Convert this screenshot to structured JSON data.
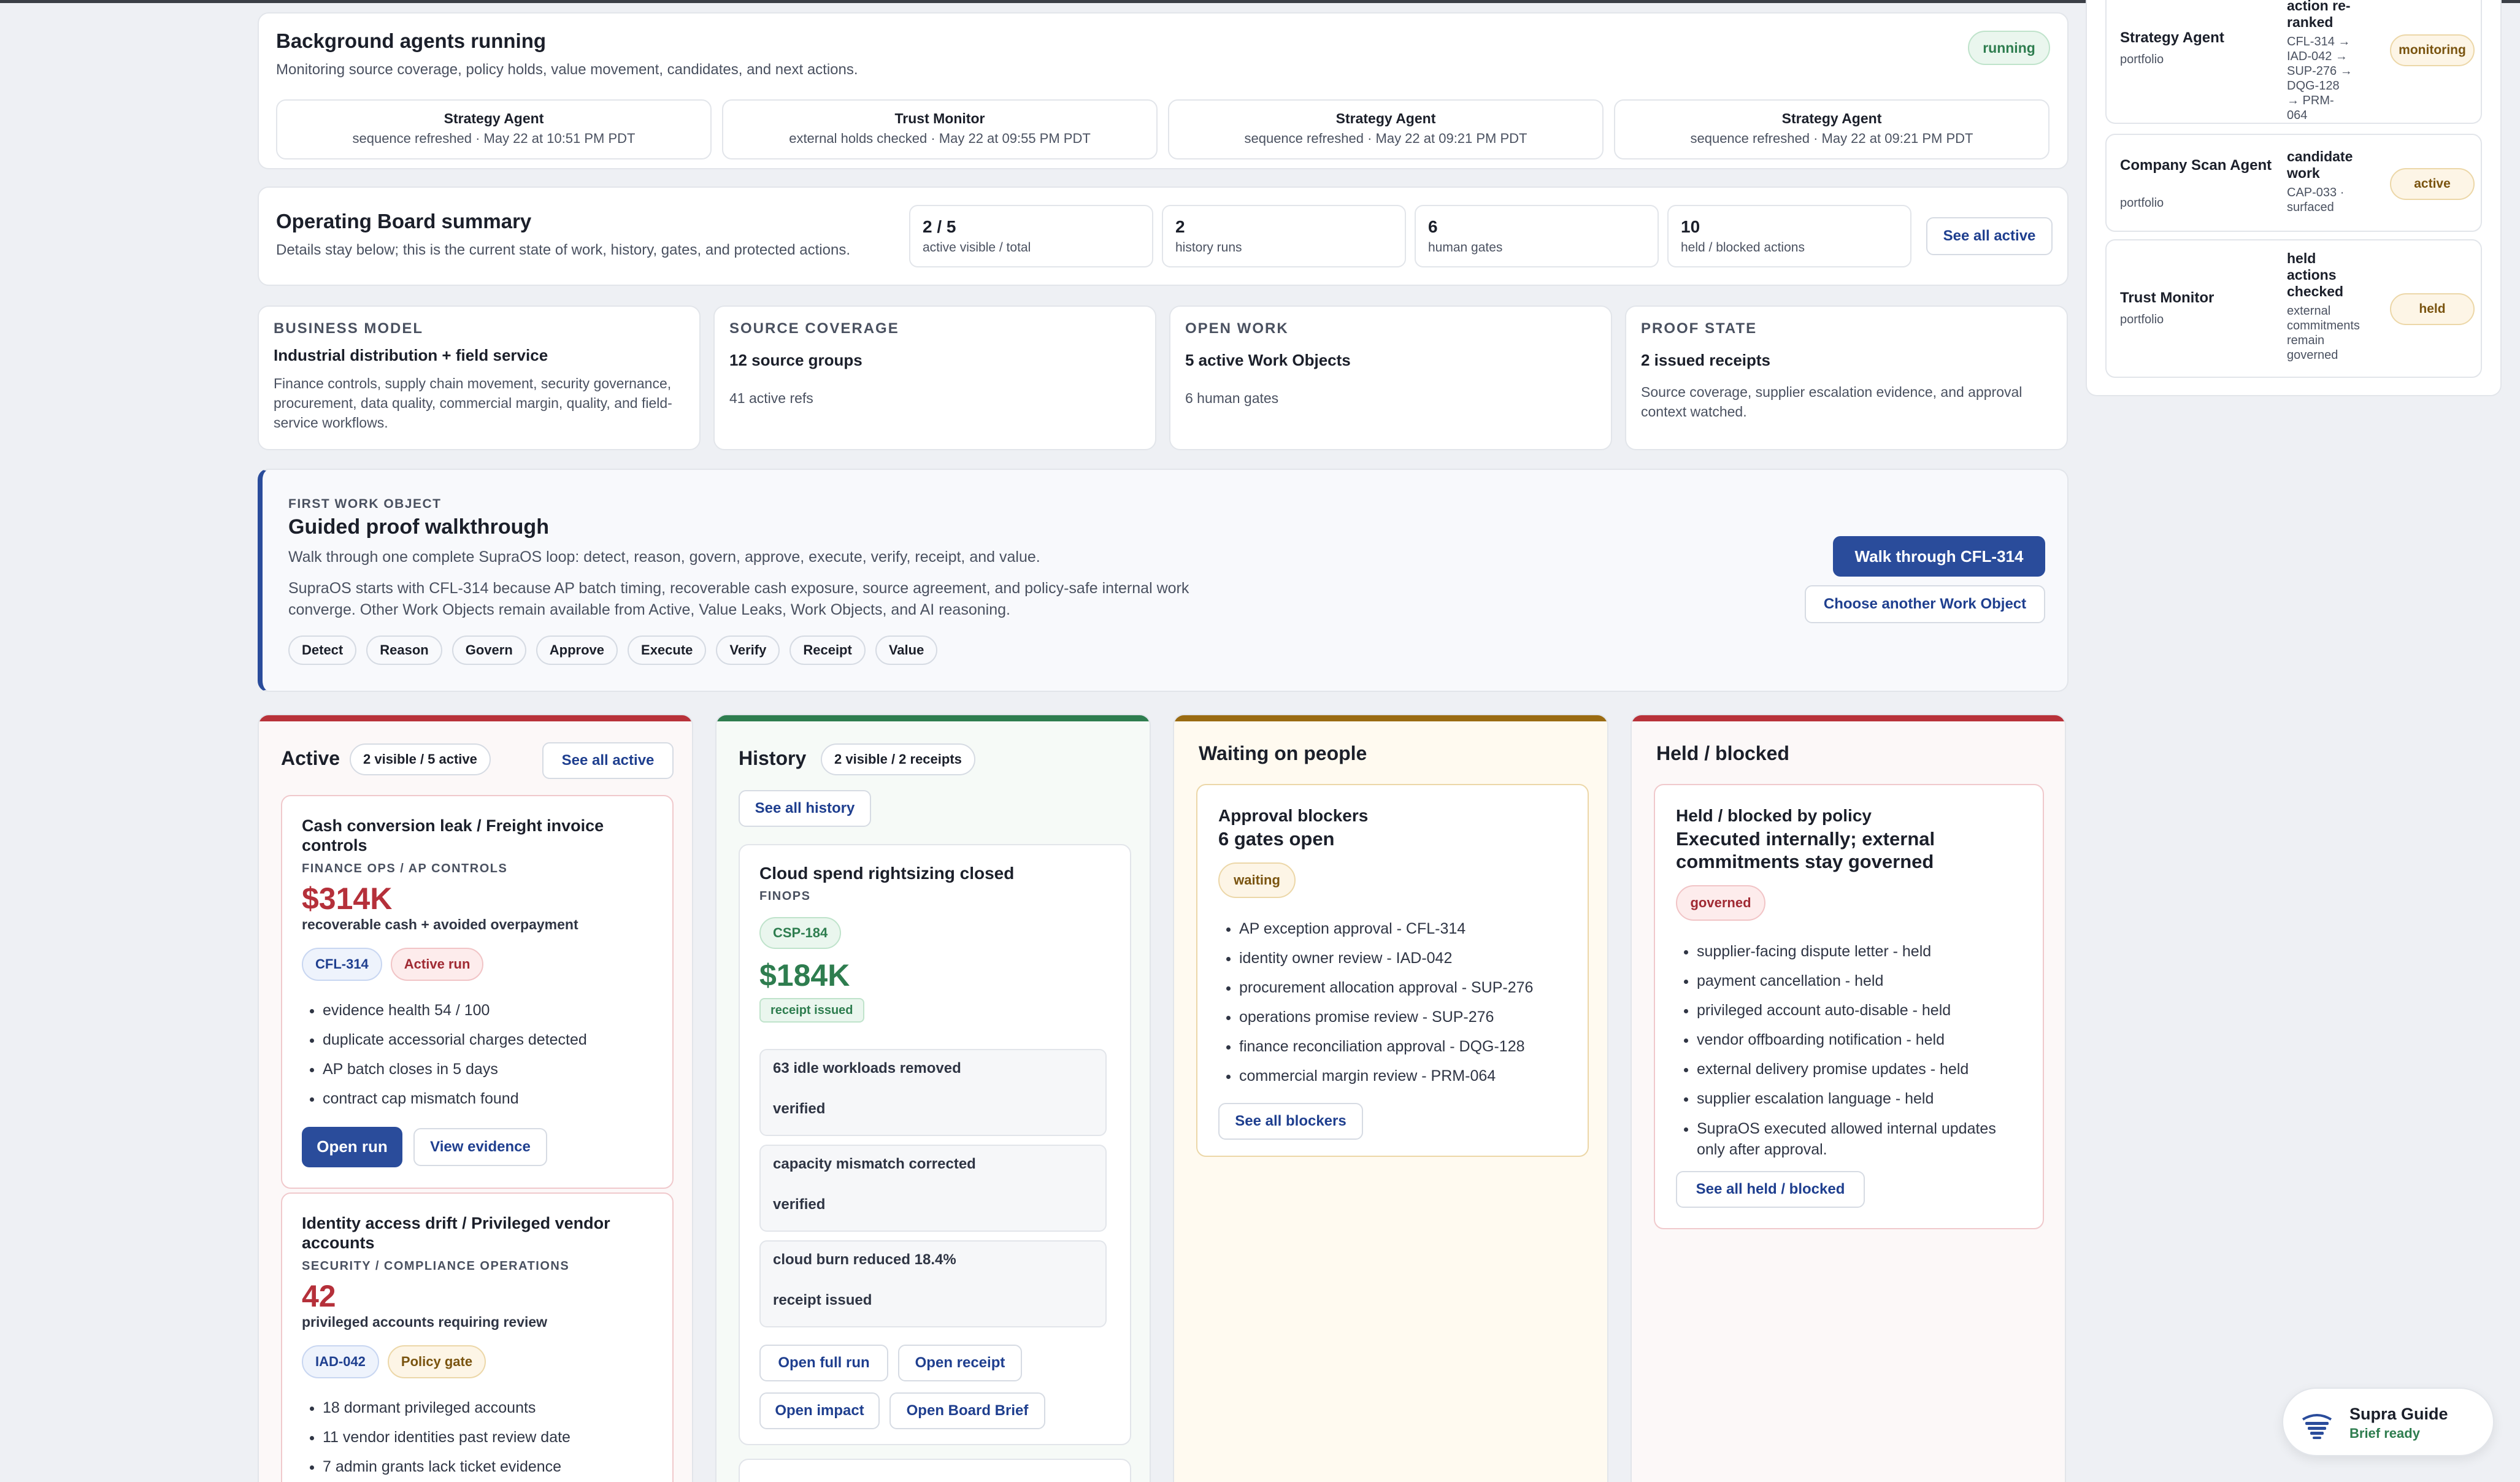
{
  "agents_card": {
    "title": "Background agents running",
    "subtitle": "Monitoring source coverage, policy holds, value movement, candidates, and next actions.",
    "status": "running",
    "agents": [
      {
        "name": "Strategy Agent",
        "status": "sequence refreshed · May 22 at 10:51 PM PDT"
      },
      {
        "name": "Trust Monitor",
        "status": "external holds checked · May 22 at 09:55 PM PDT"
      },
      {
        "name": "Strategy Agent",
        "status": "sequence refreshed · May 22 at 09:21 PM PDT"
      },
      {
        "name": "Strategy Agent",
        "status": "sequence refreshed · May 22 at 09:21 PM PDT"
      }
    ]
  },
  "summary": {
    "title": "Operating Board summary",
    "subtitle": "Details stay below; this is the current state of work, history, gates, and protected actions.",
    "stats": [
      {
        "value": "2 / 5",
        "label": "active visible / total"
      },
      {
        "value": "2",
        "label": "history runs"
      },
      {
        "value": "6",
        "label": "human gates"
      },
      {
        "value": "10",
        "label": "held / blocked actions"
      }
    ],
    "see_all": "See all active"
  },
  "metrics": [
    {
      "label": "BUSINESS MODEL",
      "title": "Industrial distribution + field service",
      "desc": "Finance controls, supply chain movement, security governance, procurement, data quality, commercial margin, quality, and field-service workflows."
    },
    {
      "label": "SOURCE COVERAGE",
      "title": "12 source groups",
      "desc": "41 active refs"
    },
    {
      "label": "OPEN WORK",
      "title": "5 active Work Objects",
      "desc": "6 human gates"
    },
    {
      "label": "PROOF STATE",
      "title": "2 issued receipts",
      "desc": "Source coverage, supplier escalation evidence, and approval context watched."
    }
  ],
  "walkthrough": {
    "eyebrow": "FIRST WORK OBJECT",
    "title": "Guided proof walkthrough",
    "line1": "Walk through one complete SupraOS loop: detect, reason, govern, approve, execute, verify, receipt, and value.",
    "line2": "SupraOS starts with CFL-314 because AP batch timing, recoverable cash exposure, source agreement, and policy-safe internal work converge. Other Work Objects remain available from Active, Value Leaks, Work Objects, and AI reasoning.",
    "steps": [
      "Detect",
      "Reason",
      "Govern",
      "Approve",
      "Execute",
      "Verify",
      "Receipt",
      "Value"
    ],
    "primary": "Walk through CFL-314",
    "secondary": "Choose another Work Object"
  },
  "active": {
    "title": "Active",
    "count": "2 visible / 5 active",
    "see_all": "See all active",
    "items": [
      {
        "title": "Cash conversion leak / Freight invoice controls",
        "dept": "FINANCE OPS / AP CONTROLS",
        "value": "$314K",
        "value_label": "recoverable cash + avoided overpayment",
        "id": "CFL-314",
        "state": "Active run",
        "bullets": [
          "evidence health 54 / 100",
          "duplicate accessorial charges detected",
          "AP batch closes in 5 days",
          "contract cap mismatch found"
        ],
        "open": "Open run",
        "evidence": "View evidence"
      },
      {
        "title": "Identity access drift / Privileged vendor accounts",
        "dept": "SECURITY / COMPLIANCE OPERATIONS",
        "value": "42",
        "value_label": "privileged accounts requiring review",
        "id": "IAD-042",
        "state": "Policy gate",
        "bullets": [
          "18 dormant privileged accounts",
          "11 vendor identities past review date",
          "7 admin grants lack ticket evidence"
        ]
      }
    ]
  },
  "history": {
    "title": "History",
    "count": "2 visible / 2 receipts",
    "see_all": "See all history",
    "item": {
      "title": "Cloud spend rightsizing closed",
      "dept": "FINOPS",
      "id": "CSP-184",
      "value": "$184K",
      "state": "receipt issued",
      "rows": [
        {
          "text": "63 idle workloads removed",
          "status": "verified"
        },
        {
          "text": "capacity mismatch corrected",
          "status": "verified"
        },
        {
          "text": "cloud burn reduced 18.4%",
          "status": "receipt issued"
        }
      ],
      "buttons": [
        "Open full run",
        "Open receipt",
        "Open impact",
        "Open Board Brief"
      ]
    }
  },
  "waiting": {
    "title": "Waiting on people",
    "box_title_1": "Approval blockers",
    "box_title_2": "6 gates open",
    "state": "waiting",
    "bullets": [
      "AP exception approval - CFL-314",
      "identity owner review - IAD-042",
      "procurement allocation approval - SUP-276",
      "operations promise review - SUP-276",
      "finance reconciliation approval - DQG-128",
      "commercial margin review - PRM-064"
    ],
    "see_all": "See all blockers"
  },
  "held": {
    "title": "Held / blocked",
    "box_title_1": "Held / blocked by policy",
    "box_title_2": "Executed internally; external commitments stay governed",
    "state": "governed",
    "bullets": [
      "supplier-facing dispute letter - held",
      "payment cancellation - held",
      "privileged account auto-disable - held",
      "vendor offboarding notification - held",
      "external delivery promise updates - held",
      "supplier escalation language - held",
      "SupraOS executed allowed internal updates only after approval."
    ],
    "see_all": "See all held / blocked"
  },
  "right_agents": [
    {
      "name": "Strategy Agent",
      "sub": "portfolio",
      "head": "action re-ranked",
      "detail": "CFL-314 → IAD-042 → SUP-276 → DQG-128 → PRM-064",
      "state": "monitoring"
    },
    {
      "name": "Company Scan Agent",
      "sub": "portfolio",
      "head": "candidate work",
      "detail": "CAP-033 · surfaced",
      "state": "active"
    },
    {
      "name": "Trust Monitor",
      "sub": "portfolio",
      "head": "held actions checked",
      "detail": "external commitments remain governed",
      "state": "held"
    }
  ],
  "guide": {
    "title": "Supra Guide",
    "status": "Brief ready"
  },
  "colors": {
    "accent": "#2a4c9b",
    "active_bar": "#b8323a",
    "history_bar": "#2e7d4f",
    "waiting_bar": "#9a6b12",
    "held_bar": "#b8323a",
    "money_red": "#b5303a",
    "money_green": "#2e7d4f"
  }
}
